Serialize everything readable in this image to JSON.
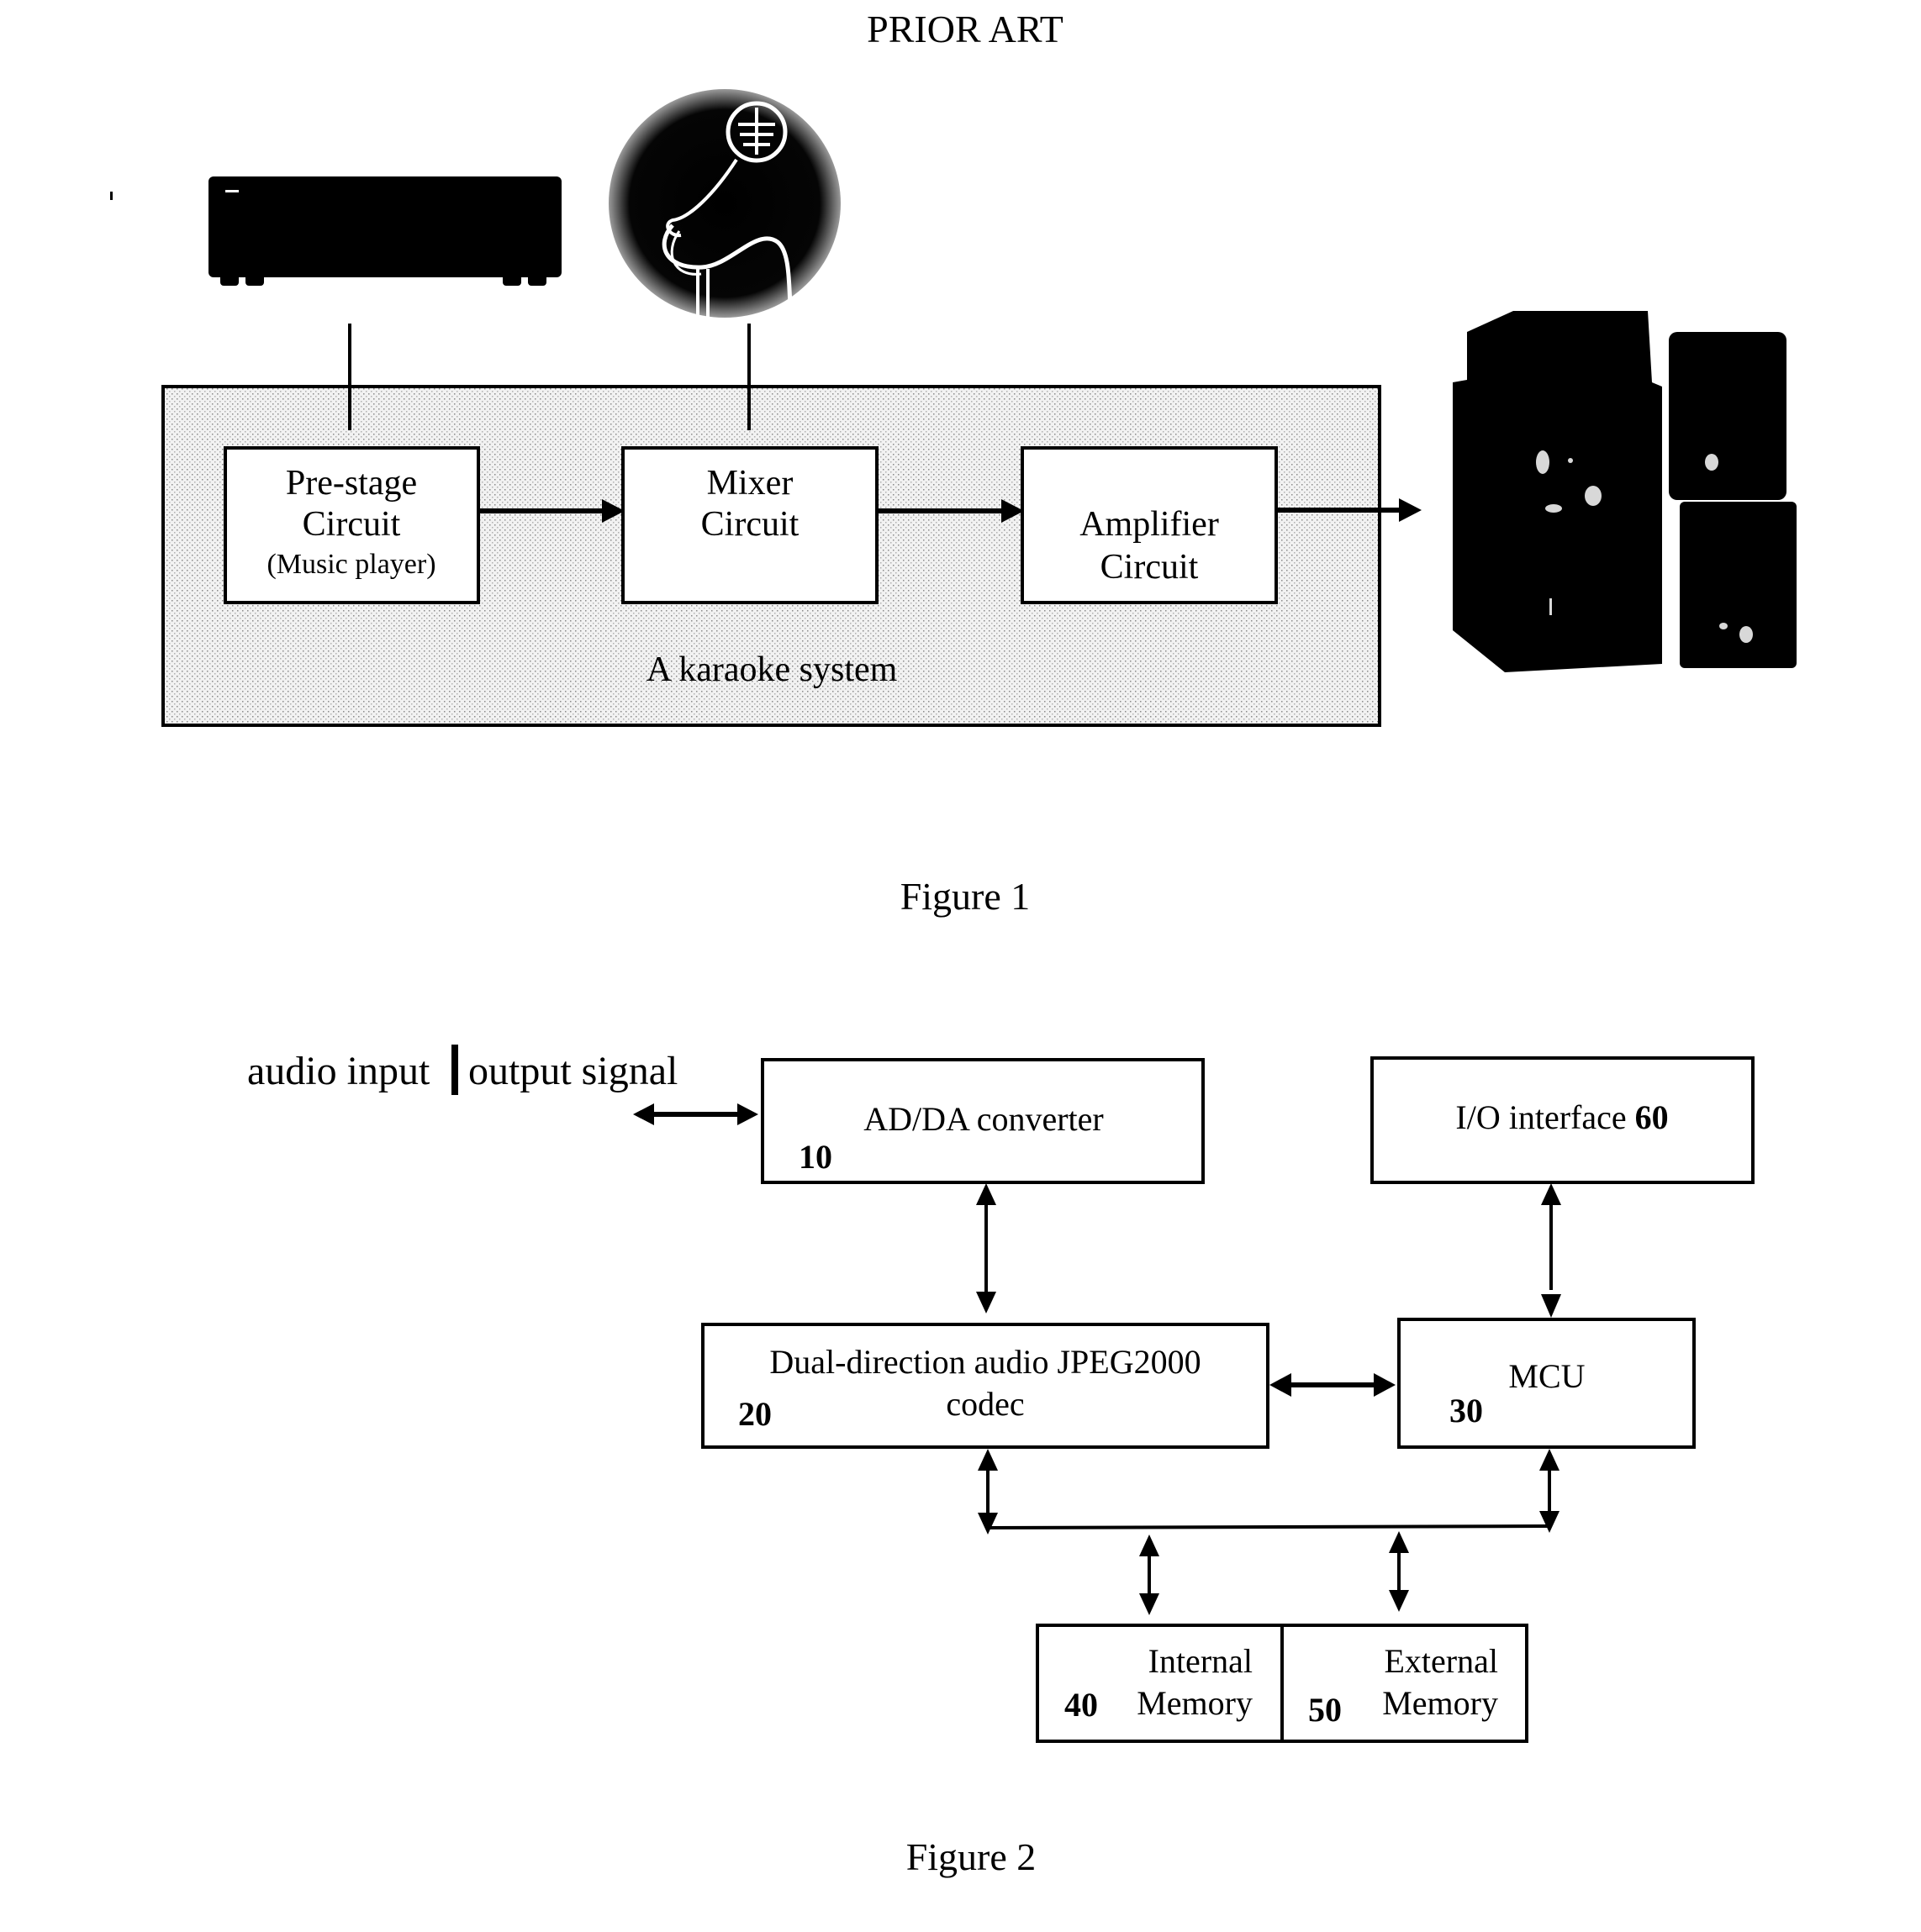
{
  "page": {
    "header": "PRIOR ART"
  },
  "figure1": {
    "caption": "Figure 1",
    "system_label": "A karaoke system",
    "inputs": [
      {
        "name": "music-player-device",
        "icon": "cd-player-icon"
      },
      {
        "name": "microphone-device",
        "icon": "microphone-icon"
      }
    ],
    "output_device": {
      "name": "speakers",
      "icon": "speaker-icon"
    },
    "blocks": [
      {
        "id": "pre-stage",
        "lines": [
          "Pre-stage",
          "Circuit"
        ],
        "sub": "(Music player)"
      },
      {
        "id": "mixer",
        "lines": [
          "Mixer",
          "Circuit"
        ]
      },
      {
        "id": "amplifier",
        "lines": [
          "Amplifier",
          "Circuit"
        ]
      }
    ],
    "colors": {
      "system_fill": "#e3e3e3",
      "device": "#000000"
    }
  },
  "figure2": {
    "caption": "Figure 2",
    "signal_label_left": "audio input",
    "signal_label_right": "output signal",
    "blocks": {
      "adda": {
        "label": "AD/DA converter",
        "number": "10"
      },
      "codec": {
        "label_line1": "Dual-direction audio JPEG2000",
        "label_line2": "codec",
        "number": "20"
      },
      "mcu": {
        "label": "MCU",
        "number": "30"
      },
      "internal_memory": {
        "label_line1": "Internal",
        "label_line2": "Memory",
        "number": "40"
      },
      "external_memory": {
        "label_line1": "External",
        "label_line2": "Memory",
        "number": "50"
      },
      "io": {
        "label": "I/O interface ",
        "number": "60"
      }
    }
  }
}
